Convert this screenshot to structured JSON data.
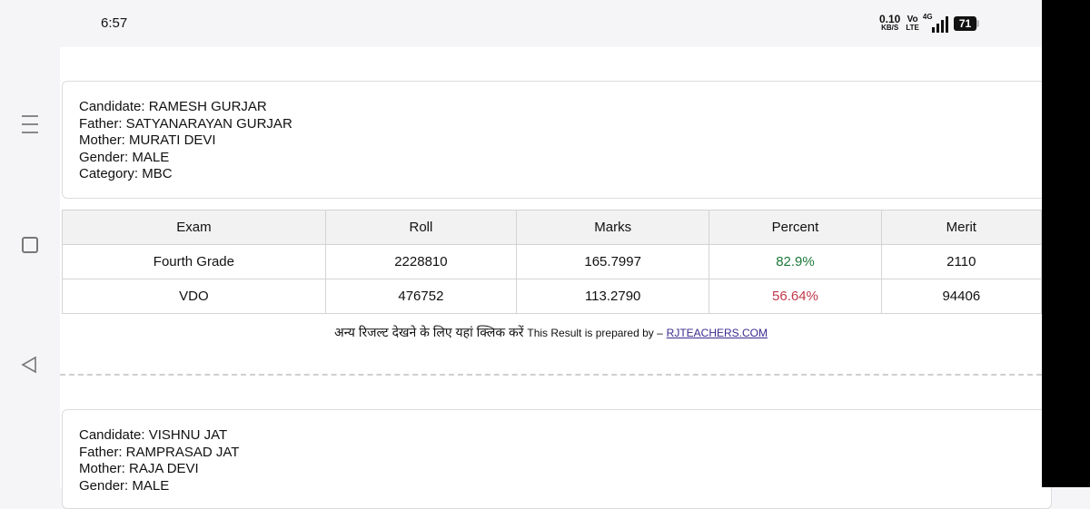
{
  "status": {
    "time": "6:57",
    "net_speed_value": "0.10",
    "net_speed_unit": "KB/S",
    "volte_top": "Vo",
    "volte_bottom": "LTE",
    "network": "4G",
    "battery": "71"
  },
  "candidates": [
    {
      "candidate": "Candidate: RAMESH GURJAR",
      "father": "Father: SATYANARAYAN GURJAR",
      "mother": "Mother: MURATI DEVI",
      "gender": "Gender: MALE",
      "category": "Category: MBC"
    },
    {
      "candidate": "Candidate: VISHNU JAT",
      "father": "Father: RAMPRASAD JAT",
      "mother": "Mother: RAJA DEVI",
      "gender": "Gender: MALE"
    }
  ],
  "table": {
    "headers": [
      "Exam",
      "Roll",
      "Marks",
      "Percent",
      "Merit"
    ],
    "rows": [
      {
        "exam": "Fourth Grade",
        "roll": "2228810",
        "marks": "165.7997",
        "percent": "82.9%",
        "merit": "2110"
      },
      {
        "exam": "VDO",
        "roll": "476752",
        "marks": "113.2790",
        "percent": "56.64%",
        "merit": "94406"
      }
    ]
  },
  "footer": {
    "hindi_text": "अन्य रिजल्ट देखने के लिए यहां क्लिक करें",
    "prepared_text": "This Result is prepared by –",
    "link_text": "RJTEACHERS.COM"
  },
  "colors": {
    "percent_good": "#1b7a3a",
    "percent_bad": "#c0394b",
    "link": "#3b2a8f"
  },
  "icons": [
    "menu-icon",
    "home-icon",
    "back-icon",
    "signal-icon",
    "battery-icon"
  ]
}
